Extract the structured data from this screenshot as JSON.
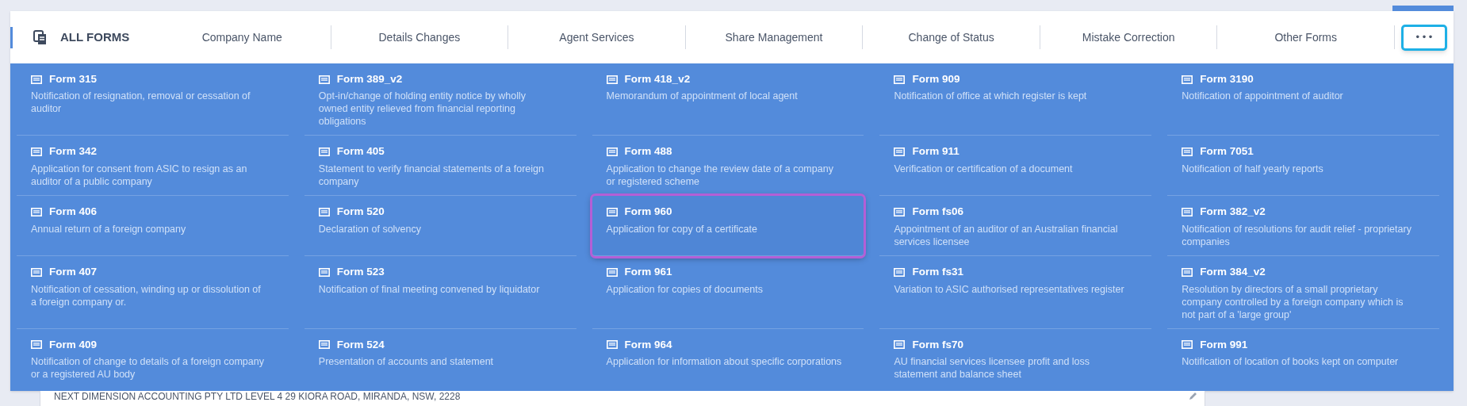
{
  "header": {
    "title": "ALL FORMS",
    "tabs": [
      {
        "label": "Company Name"
      },
      {
        "label": "Details Changes"
      },
      {
        "label": "Agent Services"
      },
      {
        "label": "Share Management"
      },
      {
        "label": "Change of Status"
      },
      {
        "label": "Mistake Correction"
      },
      {
        "label": "Other Forms"
      }
    ],
    "more_button": {
      "label": "• • •",
      "focused": true
    }
  },
  "forms": [
    {
      "title": "Form 315",
      "description": "Notification of resignation, removal or cessation of auditor",
      "highlighted": false
    },
    {
      "title": "Form 389_v2",
      "description": "Opt-in/change of holding entity notice by wholly owned entity relieved from financial reporting obligations",
      "highlighted": false
    },
    {
      "title": "Form 418_v2",
      "description": "Memorandum of appointment of local agent",
      "highlighted": false
    },
    {
      "title": "Form 909",
      "description": "Notification of office at which register is kept",
      "highlighted": false
    },
    {
      "title": "Form 3190",
      "description": "Notification of appointment of auditor",
      "highlighted": false
    },
    {
      "title": "Form 342",
      "description": "Application for consent from ASIC to resign as an auditor of a public company",
      "highlighted": false
    },
    {
      "title": "Form 405",
      "description": "Statement to verify financial statements of a foreign company",
      "highlighted": false
    },
    {
      "title": "Form 488",
      "description": "Application to change the review date of a company or registered scheme",
      "highlighted": false
    },
    {
      "title": "Form 911",
      "description": "Verification or certification of a document",
      "highlighted": false
    },
    {
      "title": "Form 7051",
      "description": "Notification of half yearly reports",
      "highlighted": false
    },
    {
      "title": "Form 406",
      "description": "Annual return of a foreign company",
      "highlighted": false
    },
    {
      "title": "Form 520",
      "description": "Declaration of solvency",
      "highlighted": false
    },
    {
      "title": "Form 960",
      "description": "Application for copy of a certificate",
      "highlighted": true
    },
    {
      "title": "Form fs06",
      "description": "Appointment of an auditor of an Australian financial services licensee",
      "highlighted": false
    },
    {
      "title": "Form 382_v2",
      "description": "Notification of resolutions for audit relief - proprietary companies",
      "highlighted": false
    },
    {
      "title": "Form 407",
      "description": "Notification of cessation, winding up or dissolution of a foreign company or.",
      "highlighted": false
    },
    {
      "title": "Form 523",
      "description": "Notification of final meeting convened by liquidator",
      "highlighted": false
    },
    {
      "title": "Form 961",
      "description": "Application for copies of documents",
      "highlighted": false
    },
    {
      "title": "Form fs31",
      "description": "Variation to ASIC authorised representatives register",
      "highlighted": false
    },
    {
      "title": "Form 384_v2",
      "description": "Resolution by directors of a small proprietary company controlled by a foreign company which is not part of a 'large group'",
      "highlighted": false
    },
    {
      "title": "Form 409",
      "description": "Notification of change to details of a foreign company or a registered AU body",
      "highlighted": false
    },
    {
      "title": "Form 524",
      "description": "Presentation of accounts and statement",
      "highlighted": false
    },
    {
      "title": "Form 964",
      "description": "Application for information about specific corporations",
      "highlighted": false
    },
    {
      "title": "Form fs70",
      "description": "AU financial services licensee profit and loss statement and balance sheet",
      "highlighted": false
    },
    {
      "title": "Form 991",
      "description": "Notification of location of books kept on computer",
      "highlighted": false
    }
  ],
  "background_row": {
    "text": "NEXT DIMENSION ACCOUNTING PTY LTD LEVEL 4 29 KIORA ROAD, MIRANDA, NSW, 2228"
  }
}
